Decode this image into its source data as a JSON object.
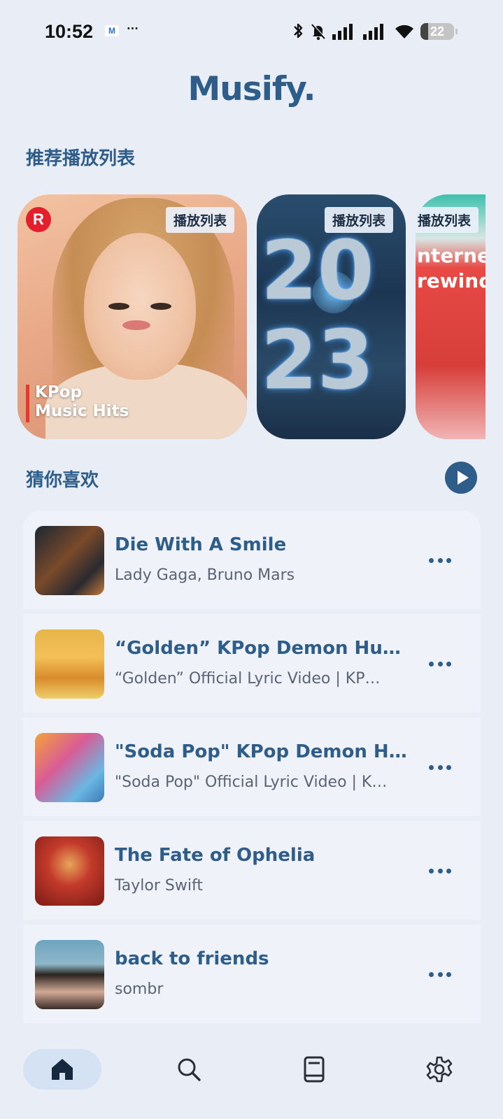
{
  "status_bar": {
    "time": "10:52",
    "notification_app": "M",
    "more": "···",
    "battery_level": "22",
    "battery_fraction": 0.22
  },
  "app": {
    "title": "Musify."
  },
  "recommended": {
    "title": "推荐播放列表",
    "cards": [
      {
        "badge": "播放列表",
        "name": "KPop\nMusic Hits",
        "name_line1": "KPop",
        "name_line2": "Music Hits",
        "logo": "R"
      },
      {
        "badge": "播放列表",
        "digits_top": "20",
        "digits_bottom": "23"
      },
      {
        "badge": "播放列表",
        "text_line1": "nterne",
        "text_line2": "rewind"
      }
    ]
  },
  "guess": {
    "title": "猜你喜欢",
    "songs": [
      {
        "title": "Die With A Smile",
        "artist": "Lady Gaga, Bruno Mars"
      },
      {
        "title": "“Golden” KPop Demon Hu…",
        "artist": "“Golden” Official Lyric Video | KP…"
      },
      {
        "title": "\"Soda Pop\" KPop Demon H…",
        "artist": "\"Soda Pop\" Official Lyric Video | K…"
      },
      {
        "title": "The Fate of Ophelia",
        "artist": "Taylor Swift"
      },
      {
        "title": "back to friends",
        "artist": "sombr"
      }
    ]
  },
  "nav": {
    "items": [
      "home-icon",
      "search-icon",
      "book-icon",
      "gear-icon"
    ],
    "active": "home"
  },
  "colors": {
    "accent": "#2e5d8a",
    "background": "#e9eef6",
    "card": "#eff2f9",
    "nav_active": "#d4e2f4"
  }
}
